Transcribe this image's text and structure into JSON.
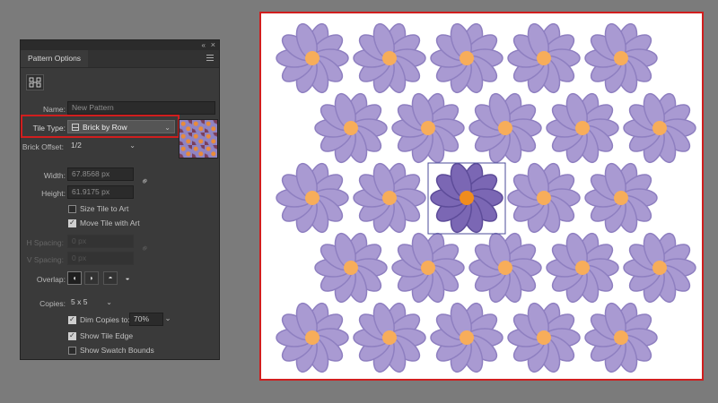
{
  "panel": {
    "title": "Pattern Options",
    "collapse_glyph": "«",
    "close_glyph": "×",
    "tile_editor_icon": "pattern-tile-tool-icon",
    "name": {
      "label": "Name:",
      "value": "New Pattern"
    },
    "tile_type": {
      "label": "Tile Type:",
      "value": "Brick by Row",
      "icon": "brick-row-icon"
    },
    "brick_offset": {
      "label": "Brick Offset:",
      "value": "1/2"
    },
    "width": {
      "label": "Width:",
      "value": "67.8568 px"
    },
    "height": {
      "label": "Height:",
      "value": "61.9175 px"
    },
    "size_tile_to_art": {
      "label": "Size Tile to Art",
      "checked": false
    },
    "move_tile_with_art": {
      "label": "Move Tile with Art",
      "checked": true
    },
    "h_spacing": {
      "label": "H Spacing:",
      "value": "0 px"
    },
    "v_spacing": {
      "label": "V Spacing:",
      "value": "0 px"
    },
    "overlap": {
      "label": "Overlap:"
    },
    "copies": {
      "label": "Copies:",
      "value": "5 x 5"
    },
    "dim_copies": {
      "label": "Dim Copies to:",
      "value": "70%",
      "checked": true
    },
    "show_tile_edge": {
      "label": "Show Tile Edge",
      "checked": true
    },
    "show_swatch_bounds": {
      "label": "Show Swatch Bounds",
      "checked": false
    }
  },
  "colors": {
    "petal_dim": "#a99ad2",
    "petal_dim_stroke": "#8e7fc0",
    "center_dim": "#f7ad5a",
    "petal_main": "#7b67b4",
    "petal_main_stroke": "#5d4c99",
    "center_main": "#f08c1e",
    "tile_edge": "#4b4b99",
    "highlight": "#d01e1e"
  }
}
